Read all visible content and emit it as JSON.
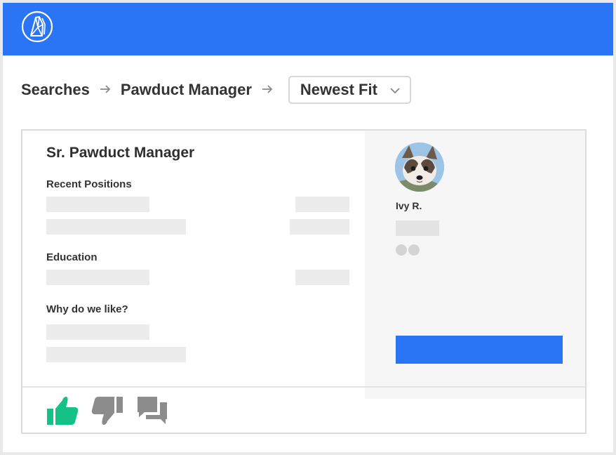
{
  "colors": {
    "brand": "#2a74f6",
    "like": "#14c186",
    "muted_icon": "#8c8c8c",
    "placeholder": "#ececec"
  },
  "header": {
    "logo_icon": "app-logo-icon"
  },
  "breadcrumb": {
    "items": [
      "Searches",
      "Pawduct Manager"
    ],
    "separator_icon": "arrow-right-icon",
    "sort_dropdown": {
      "selected": "Newest Fit",
      "icon": "chevron-down-icon"
    }
  },
  "card": {
    "job_title": "Sr. Pawduct Manager",
    "sections": {
      "recent_positions": "Recent Positions",
      "education": "Education",
      "why_like": "Why do we like?"
    },
    "candidate": {
      "name": "Ivy R.",
      "avatar_icon": "dog-avatar"
    },
    "actions": [
      "thumbs-up-icon",
      "thumbs-down-icon",
      "comments-icon"
    ]
  }
}
